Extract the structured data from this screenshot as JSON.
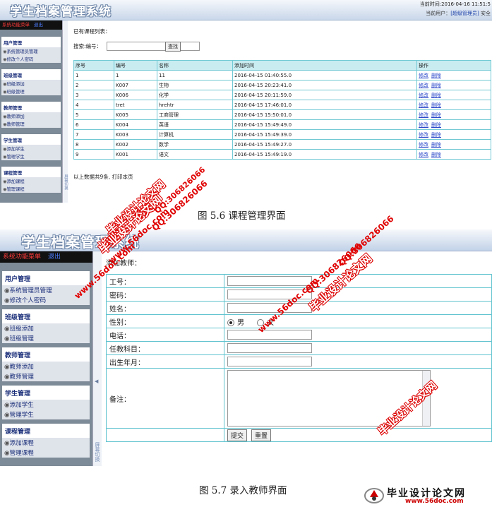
{
  "top": {
    "app_title": "学生档案管理系统",
    "time_text": "当前时间:2016-04-16 11:51:5",
    "user_text": "当前用户：",
    "user_name": "[超级管理员]",
    "safe_text": "安全",
    "menu_label": "系统功能菜单",
    "exit_label": "退出",
    "groups": [
      {
        "title": "用户管理",
        "items": [
          "系统管理员管理",
          "修改个人密码"
        ]
      },
      {
        "title": "班级管理",
        "items": [
          "班级添加",
          "班级管理"
        ]
      },
      {
        "title": "教师管理",
        "items": [
          "教师添加",
          "教师管理"
        ]
      },
      {
        "title": "学生管理",
        "items": [
          "添加学生",
          "管理学生"
        ]
      },
      {
        "title": "课程管理",
        "items": [
          "添加课程",
          "管理课程"
        ]
      }
    ],
    "split_label": "屏幕切换",
    "list_title": "已有课程列表：",
    "search_label": "搜索:编号：",
    "search_button": "查找",
    "columns": [
      "序号",
      "编号",
      "名称",
      "添加时间",
      "操作"
    ],
    "rows": [
      [
        "1",
        "1",
        "11",
        "2016-04-15 01:40:55.0"
      ],
      [
        "2",
        "K007",
        "生物",
        "2016-04-15 20:23:41.0"
      ],
      [
        "3",
        "K006",
        "化学",
        "2016-04-15 20:11:59.0"
      ],
      [
        "4",
        "tret",
        "hrehtr",
        "2016-04-15 17:46:01.0"
      ],
      [
        "5",
        "K005",
        "工商管理",
        "2016-04-15 15:50:01.0"
      ],
      [
        "6",
        "K004",
        "英语",
        "2016-04-15 15:49:49.0"
      ],
      [
        "7",
        "K003",
        "计算机",
        "2016-04-15 15:49:39.0"
      ],
      [
        "8",
        "K002",
        "数学",
        "2016-04-15 15:49:27.0"
      ],
      [
        "9",
        "K001",
        "语文",
        "2016-04-15 15:49:19.0"
      ]
    ],
    "edit_label": "修改",
    "delete_label": "删除",
    "footer": "以上数据共9条, 打印本页"
  },
  "caption1": "图 5.6 课程管理界面",
  "bottom": {
    "app_title": "学生档案管理系统",
    "menu_label": "系统功能菜单",
    "exit_label": "退出",
    "groups": [
      {
        "title": "用户管理",
        "items": [
          "系统管理员管理",
          "修改个人密码"
        ]
      },
      {
        "title": "班级管理",
        "items": [
          "班级添加",
          "班级管理"
        ]
      },
      {
        "title": "教师管理",
        "items": [
          "教师添加",
          "教师管理"
        ]
      },
      {
        "title": "学生管理",
        "items": [
          "添加学生",
          "管理学生"
        ]
      },
      {
        "title": "课程管理",
        "items": [
          "添加课程",
          "管理课程"
        ]
      }
    ],
    "split_label": "屏幕切换",
    "form_title": "添加教师：",
    "fields": {
      "id": "工号：",
      "pwd": "密码：",
      "name": "姓名：",
      "gender": "性别：",
      "male": "男",
      "female": "女",
      "phone": "电话：",
      "subject": "任教科目：",
      "birth": "出生年月：",
      "remark": "备注："
    },
    "submit_label": "提交",
    "reset_label": "重置"
  },
  "caption2": "图 5.7 录入教师界面",
  "watermarks": {
    "site": "www.56doc.com",
    "qq": "QQ:306826066",
    "brand": "毕业设计论文网",
    "logo_text": "毕业设计论文网",
    "logo_url": "www.56doc.com"
  }
}
